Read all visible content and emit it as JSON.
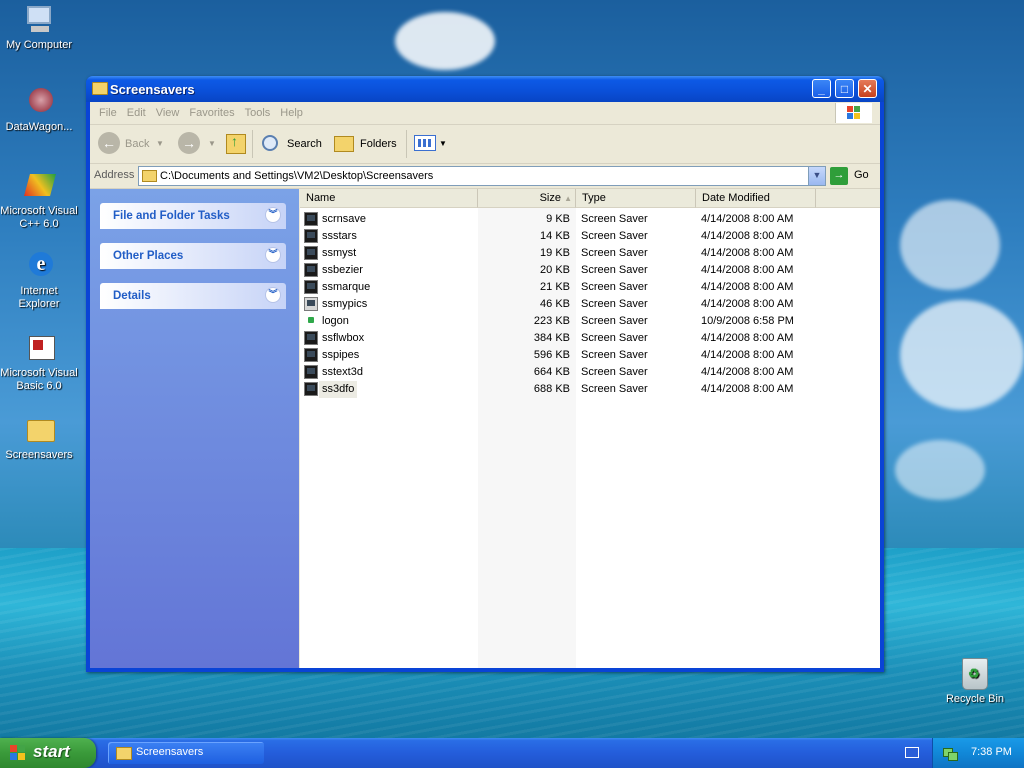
{
  "desktop": {
    "icons": [
      {
        "label": "My Computer"
      },
      {
        "label": "DataWagon..."
      },
      {
        "label": "Microsoft Visual C++ 6.0"
      },
      {
        "label": "Internet Explorer"
      },
      {
        "label": "Microsoft Visual Basic 6.0"
      },
      {
        "label": "Screensavers"
      }
    ],
    "recycle_bin": "Recycle Bin"
  },
  "window": {
    "title": "Screensavers",
    "menu": [
      "File",
      "Edit",
      "View",
      "Favorites",
      "Tools",
      "Help"
    ],
    "toolbar": {
      "back": "Back",
      "search": "Search",
      "folders": "Folders"
    },
    "address": {
      "label": "Address",
      "value": "C:\\Documents and Settings\\VM2\\Desktop\\Screensavers",
      "go": "Go"
    },
    "tasks": [
      {
        "label": "File and Folder Tasks"
      },
      {
        "label": "Other Places"
      },
      {
        "label": "Details"
      }
    ],
    "columns": {
      "name": "Name",
      "size": "Size",
      "type": "Type",
      "date": "Date Modified"
    },
    "files": [
      {
        "name": "scrnsave",
        "size": "9 KB",
        "type": "Screen Saver",
        "date": "4/14/2008 8:00 AM"
      },
      {
        "name": "ssstars",
        "size": "14 KB",
        "type": "Screen Saver",
        "date": "4/14/2008 8:00 AM"
      },
      {
        "name": "ssmyst",
        "size": "19 KB",
        "type": "Screen Saver",
        "date": "4/14/2008 8:00 AM"
      },
      {
        "name": "ssbezier",
        "size": "20 KB",
        "type": "Screen Saver",
        "date": "4/14/2008 8:00 AM"
      },
      {
        "name": "ssmarque",
        "size": "21 KB",
        "type": "Screen Saver",
        "date": "4/14/2008 8:00 AM"
      },
      {
        "name": "ssmypics",
        "size": "46 KB",
        "type": "Screen Saver",
        "date": "4/14/2008 8:00 AM"
      },
      {
        "name": "logon",
        "size": "223 KB",
        "type": "Screen Saver",
        "date": "10/9/2008 6:58 PM"
      },
      {
        "name": "ssflwbox",
        "size": "384 KB",
        "type": "Screen Saver",
        "date": "4/14/2008 8:00 AM"
      },
      {
        "name": "sspipes",
        "size": "596 KB",
        "type": "Screen Saver",
        "date": "4/14/2008 8:00 AM"
      },
      {
        "name": "sstext3d",
        "size": "664 KB",
        "type": "Screen Saver",
        "date": "4/14/2008 8:00 AM"
      },
      {
        "name": "ss3dfo",
        "size": "688 KB",
        "type": "Screen Saver",
        "date": "4/14/2008 8:00 AM"
      }
    ]
  },
  "taskbar": {
    "start": "start",
    "task": "Screensavers",
    "clock": "7:38 PM"
  }
}
